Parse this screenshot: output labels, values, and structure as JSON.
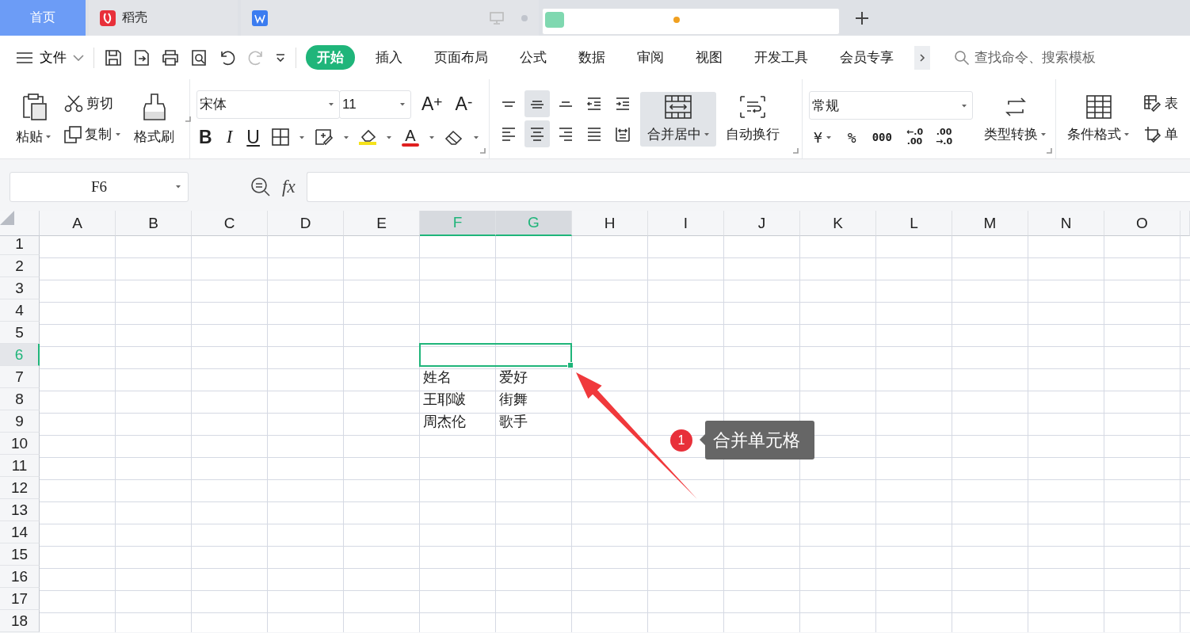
{
  "tabs": [
    {
      "label": "首页",
      "kind": "home",
      "selected": false
    },
    {
      "label": "稻壳",
      "kind": "docer",
      "selected": false
    },
    {
      "kind": "writer",
      "selected": false
    },
    {
      "kind": "sheet",
      "selected": true
    }
  ],
  "menu": {
    "file": "文件",
    "items": [
      {
        "label": "开始",
        "selected": true
      },
      {
        "label": "插入",
        "selected": false
      },
      {
        "label": "页面布局",
        "selected": false
      },
      {
        "label": "公式",
        "selected": false
      },
      {
        "label": "数据",
        "selected": false
      },
      {
        "label": "审阅",
        "selected": false
      },
      {
        "label": "视图",
        "selected": false
      },
      {
        "label": "开发工具",
        "selected": false
      },
      {
        "label": "会员专享",
        "selected": false
      }
    ],
    "search": {
      "placeholder": "查找命令、搜索模板"
    }
  },
  "ribbon": {
    "clipboard": {
      "paste": "粘贴",
      "cut": "剪切",
      "copy": "复制",
      "format_painter": "格式刷"
    },
    "font": {
      "family": "宋体",
      "size": "11",
      "grow": "A$^{+}$",
      "shrink": "A$^{-}$",
      "bold": "B",
      "italic": "I",
      "underline": "U",
      "font_color": "A"
    },
    "alignment": {
      "buttons": [
        {
          "kind": "top",
          "selected": false
        },
        {
          "kind": "middle",
          "selected": true
        },
        {
          "kind": "bottom",
          "selected": false
        },
        {
          "kind": "outdent",
          "selected": false
        },
        {
          "kind": "indent",
          "selected": false
        },
        {
          "kind": "left",
          "selected": false
        },
        {
          "kind": "center",
          "selected": true
        },
        {
          "kind": "right",
          "selected": false
        },
        {
          "kind": "justify",
          "selected": false
        },
        {
          "kind": "distribute",
          "selected": false
        }
      ],
      "merge": {
        "label": "合并居中",
        "selected": true
      },
      "wrap": "自动换行"
    },
    "number": {
      "format": "常规",
      "currency": "¥",
      "percent": "%",
      "thousands": "000",
      "increase_decimal": [
        "←.0",
        ".00"
      ],
      "decrease_decimal": [
        ".00",
        "→.0"
      ],
      "convert": "类型转换"
    },
    "styles": {
      "conditional": "条件格式",
      "table": "表",
      "cell": "单"
    }
  },
  "formula_bar": {
    "name_box": "F6",
    "fx": "fx"
  },
  "grid": {
    "columns": [
      {
        "label": "A",
        "selected": false
      },
      {
        "label": "B",
        "selected": false
      },
      {
        "label": "C",
        "selected": false
      },
      {
        "label": "D",
        "selected": false
      },
      {
        "label": "E",
        "selected": false
      },
      {
        "label": "F",
        "selected": true
      },
      {
        "label": "G",
        "selected": true
      },
      {
        "label": "H",
        "selected": false
      },
      {
        "label": "I",
        "selected": false
      },
      {
        "label": "J",
        "selected": false
      },
      {
        "label": "K",
        "selected": false
      },
      {
        "label": "L",
        "selected": false
      },
      {
        "label": "M",
        "selected": false
      },
      {
        "label": "N",
        "selected": false
      },
      {
        "label": "O",
        "selected": false
      }
    ],
    "rows": [
      {
        "label": "1",
        "selected": false
      },
      {
        "label": "2",
        "selected": false
      },
      {
        "label": "3",
        "selected": false
      },
      {
        "label": "4",
        "selected": false
      },
      {
        "label": "5",
        "selected": false
      },
      {
        "label": "6",
        "selected": true
      },
      {
        "label": "7",
        "selected": false,
        "cells": [
          null,
          null,
          null,
          null,
          null,
          "姓名",
          "爱好"
        ]
      },
      {
        "label": "8",
        "selected": false,
        "cells": [
          null,
          null,
          null,
          null,
          null,
          "王耶啵",
          "街舞"
        ]
      },
      {
        "label": "9",
        "selected": false,
        "cells": [
          null,
          null,
          null,
          null,
          null,
          "周杰伦",
          "歌手"
        ]
      },
      {
        "label": "10",
        "selected": false
      },
      {
        "label": "11",
        "selected": false
      },
      {
        "label": "12",
        "selected": false
      },
      {
        "label": "13",
        "selected": false
      },
      {
        "label": "14",
        "selected": false
      },
      {
        "label": "15",
        "selected": false
      },
      {
        "label": "16",
        "selected": false
      },
      {
        "label": "17",
        "selected": false
      },
      {
        "label": "18",
        "selected": false
      }
    ]
  },
  "annotation": {
    "number": "1",
    "text": "合并单元格"
  }
}
